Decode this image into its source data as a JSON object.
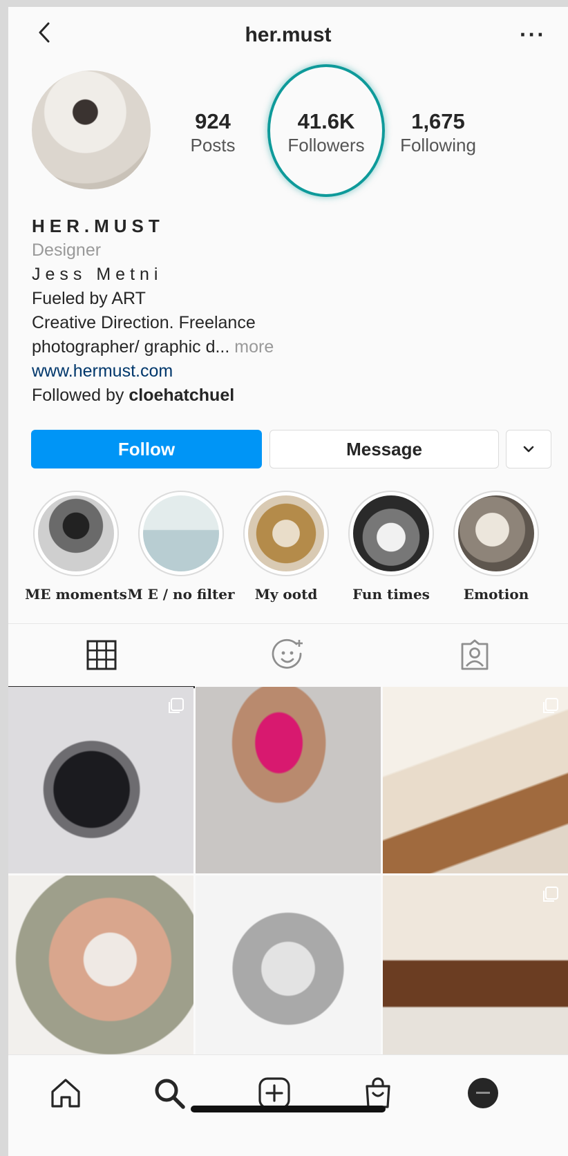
{
  "header": {
    "title": "her.must",
    "more_label": "···"
  },
  "stats": [
    {
      "number": "924",
      "label": "Posts"
    },
    {
      "number": "41.6K",
      "label": "Followers"
    },
    {
      "number": "1,675",
      "label": "Following"
    }
  ],
  "bio": {
    "display_name": "HER.MUST",
    "category": "Designer",
    "real_name": "Jess Metni",
    "line1": "Fueled by ART",
    "line2": "Creative Direction. Freelance",
    "line3": "photographer/ graphic d...",
    "more": "more",
    "link": "www.hermust.com",
    "followed_prefix": "Followed by",
    "followed_user": "cloehatchuel"
  },
  "buttons": {
    "follow": "Follow",
    "message": "Message"
  },
  "highlights": [
    {
      "label": "ME moments"
    },
    {
      "label": "M E / no filter"
    },
    {
      "label": "My ootd"
    },
    {
      "label": "Fun times"
    },
    {
      "label": "Emotion"
    }
  ],
  "tabs": [
    {
      "icon": "grid-icon"
    },
    {
      "icon": "reels-face-icon"
    },
    {
      "icon": "tagged-user-icon"
    }
  ],
  "nav": [
    {
      "icon": "home-icon"
    },
    {
      "icon": "search-icon"
    },
    {
      "icon": "add-post-icon"
    },
    {
      "icon": "shop-bag-icon"
    },
    {
      "icon": "profile-avatar-icon"
    }
  ]
}
